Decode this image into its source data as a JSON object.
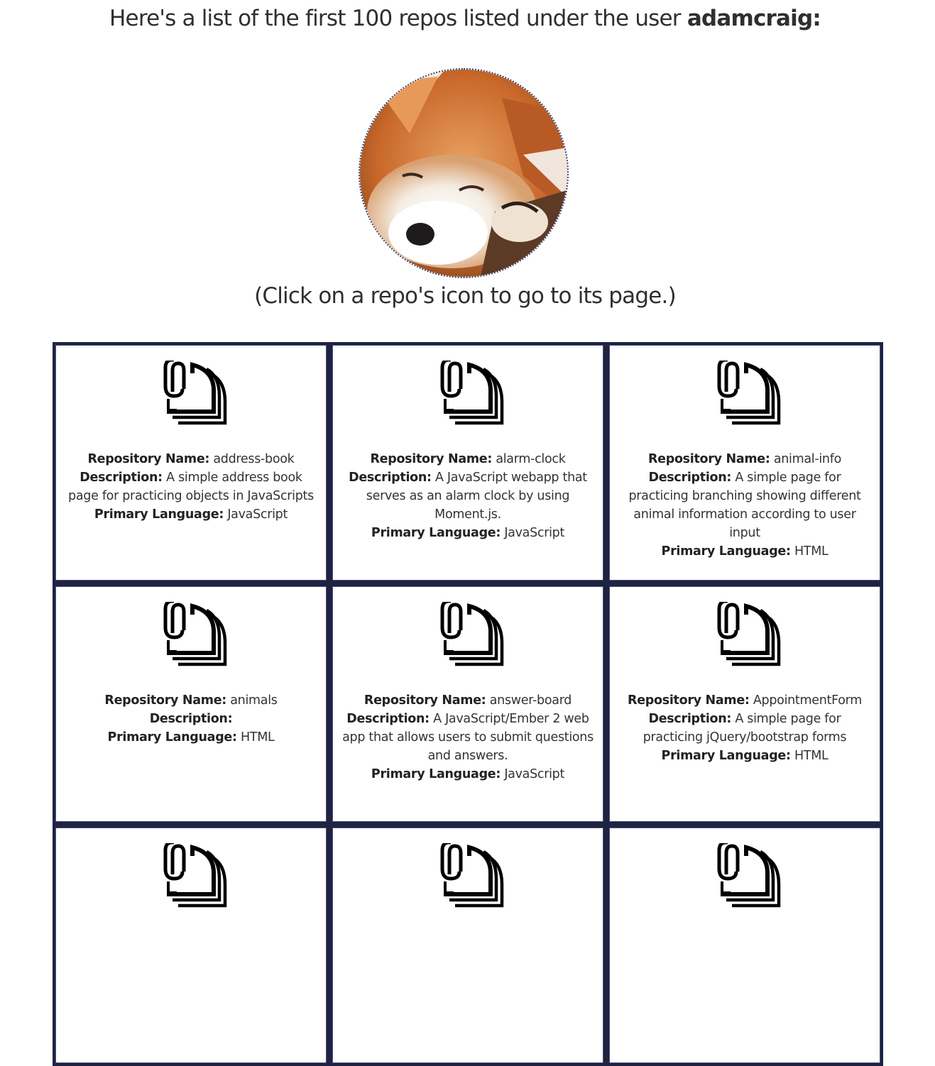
{
  "heading": {
    "prefix": "Here's a list of the first 100 repos listed under the user ",
    "username": "adamcraig:"
  },
  "avatar_alt": "red panda avatar",
  "hint": "(Click on a repo's icon to go to its page.)",
  "labels": {
    "name": "Repository Name:",
    "description": "Description:",
    "language": "Primary Language:"
  },
  "repos": [
    {
      "name": "address-book",
      "description": "A simple address book page for practicing objects in JavaScripts",
      "language": "JavaScript"
    },
    {
      "name": "alarm-clock",
      "description": "A JavaScript webapp that serves as an alarm clock by using Moment.js.",
      "language": "JavaScript"
    },
    {
      "name": "animal-info",
      "description": "A simple page for practicing branching showing different animal information according to user input",
      "language": "HTML"
    },
    {
      "name": "animals",
      "description": "",
      "language": "HTML"
    },
    {
      "name": "answer-board",
      "description": "A JavaScript/Ember 2 web app that allows users to submit questions and answers.",
      "language": "JavaScript"
    },
    {
      "name": "AppointmentForm",
      "description": "A simple page for practicing jQuery/bootstrap forms",
      "language": "HTML"
    }
  ],
  "icon": "repo-files-clip-icon"
}
